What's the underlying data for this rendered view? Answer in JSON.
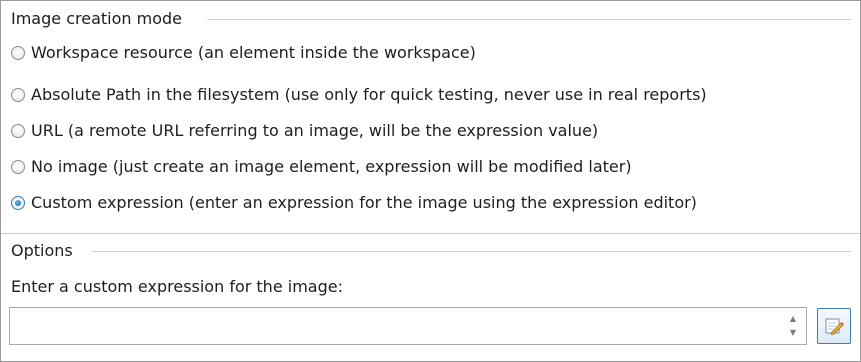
{
  "image_creation_mode": {
    "title": "Image creation mode",
    "options": [
      {
        "label": "Workspace resource (an element inside the workspace)",
        "checked": false
      },
      {
        "label": "Absolute Path in the filesystem (use only for quick testing, never use in real reports)",
        "checked": false
      },
      {
        "label": "URL (a remote URL referring to an image, will be the expression value)",
        "checked": false
      },
      {
        "label": "No image (just create an image element, expression will be modified later)",
        "checked": false
      },
      {
        "label": "Custom expression (enter an expression for the image using the expression editor)",
        "checked": true
      }
    ]
  },
  "options": {
    "title": "Options",
    "prompt": "Enter a custom expression for the image:",
    "expression_value": "",
    "spinner_up": "▲",
    "spinner_down": "▼",
    "edit_button_icon": "pencil-edit-icon"
  },
  "colors": {
    "accent": "#3c7fb1",
    "border": "#9a9a9a",
    "group_line": "#d5d5d5"
  }
}
